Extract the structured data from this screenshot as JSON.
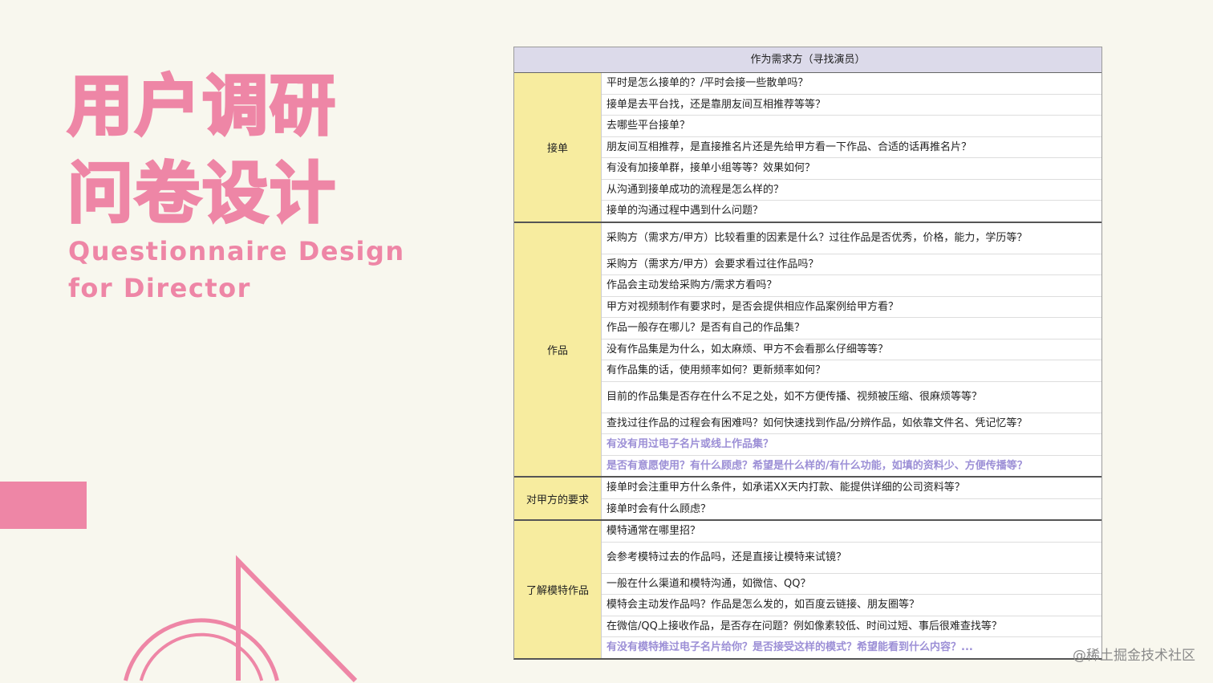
{
  "slide": {
    "title_cn": [
      "用户调研",
      "问卷设计"
    ],
    "title_en": [
      "Questionnaire Design",
      "for Director"
    ],
    "accent_color": "#ee86a6",
    "watermark": "@稀土掘金技术社区"
  },
  "table": {
    "header": "作为需求方（寻找演员）",
    "sections": [
      {
        "category": "接单",
        "rows": [
          {
            "text": "平时是怎么接单的？/平时会接一些散单吗？"
          },
          {
            "text": "接单是去平台找，还是靠朋友间互相推荐等等？"
          },
          {
            "text": "去哪些平台接单？"
          },
          {
            "text": "朋友间互相推荐，是直接推名片还是先给甲方看一下作品、合适的话再推名片？"
          },
          {
            "text": "有没有加接单群，接单小组等等？效果如何？"
          },
          {
            "text": "从沟通到接单成功的流程是怎么样的？"
          },
          {
            "text": "接单的沟通过程中遇到什么问题？"
          }
        ]
      },
      {
        "category": "作品",
        "rows": [
          {
            "text": "采购方（需求方/甲方）比较看重的因素是什么？过往作品是否优秀，价格，能力，学历等？"
          },
          {
            "text": "采购方（需求方/甲方）会要求看过往作品吗？"
          },
          {
            "text": "作品会主动发给采购方/需求方看吗？"
          },
          {
            "text": "甲方对视频制作有要求时，是否会提供相应作品案例给甲方看？"
          },
          {
            "text": "作品一般存在哪儿？是否有自己的作品集？"
          },
          {
            "text": "没有作品集是为什么，如太麻烦、甲方不会看那么仔细等等？"
          },
          {
            "text": "有作品集的话，使用频率如何？更新频率如何？"
          },
          {
            "text": "目前的作品集是否存在什么不足之处，如不方便传播、视频被压缩、很麻烦等等？"
          },
          {
            "text": "查找过往作品的过程会有困难吗？如何快速找到作品/分辨作品，如依靠文件名、凭记忆等？"
          },
          {
            "text": "有没有用过电子名片或线上作品集？",
            "highlight": true
          },
          {
            "text": "是否有意愿使用？有什么顾虑？希望是什么样的/有什么功能，如填的资料少、方便传播等？",
            "highlight": true
          }
        ]
      },
      {
        "category": "对甲方的要求",
        "rows": [
          {
            "text": "接单时会注重甲方什么条件，如承诺XX天内打款、能提供详细的公司资料等？"
          },
          {
            "text": "接单时会有什么顾虑？"
          }
        ]
      },
      {
        "category": "了解模特作品",
        "rows": [
          {
            "text": "模特通常在哪里招？"
          },
          {
            "text": "会参考模特过去的作品吗，还是直接让模特来试镜？"
          },
          {
            "text": "一般在什么渠道和模特沟通，如微信、QQ？"
          },
          {
            "text": "模特会主动发作品吗？作品是怎么发的，如百度云链接、朋友圈等？"
          },
          {
            "text": "在微信/QQ上接收作品，是否存在问题？例如像素较低、时间过短、事后很难查找等？"
          },
          {
            "text": "有没有模特推过电子名片给你？是否接受这样的模式？希望能看到什么内容？...",
            "highlight": true
          }
        ]
      }
    ]
  }
}
